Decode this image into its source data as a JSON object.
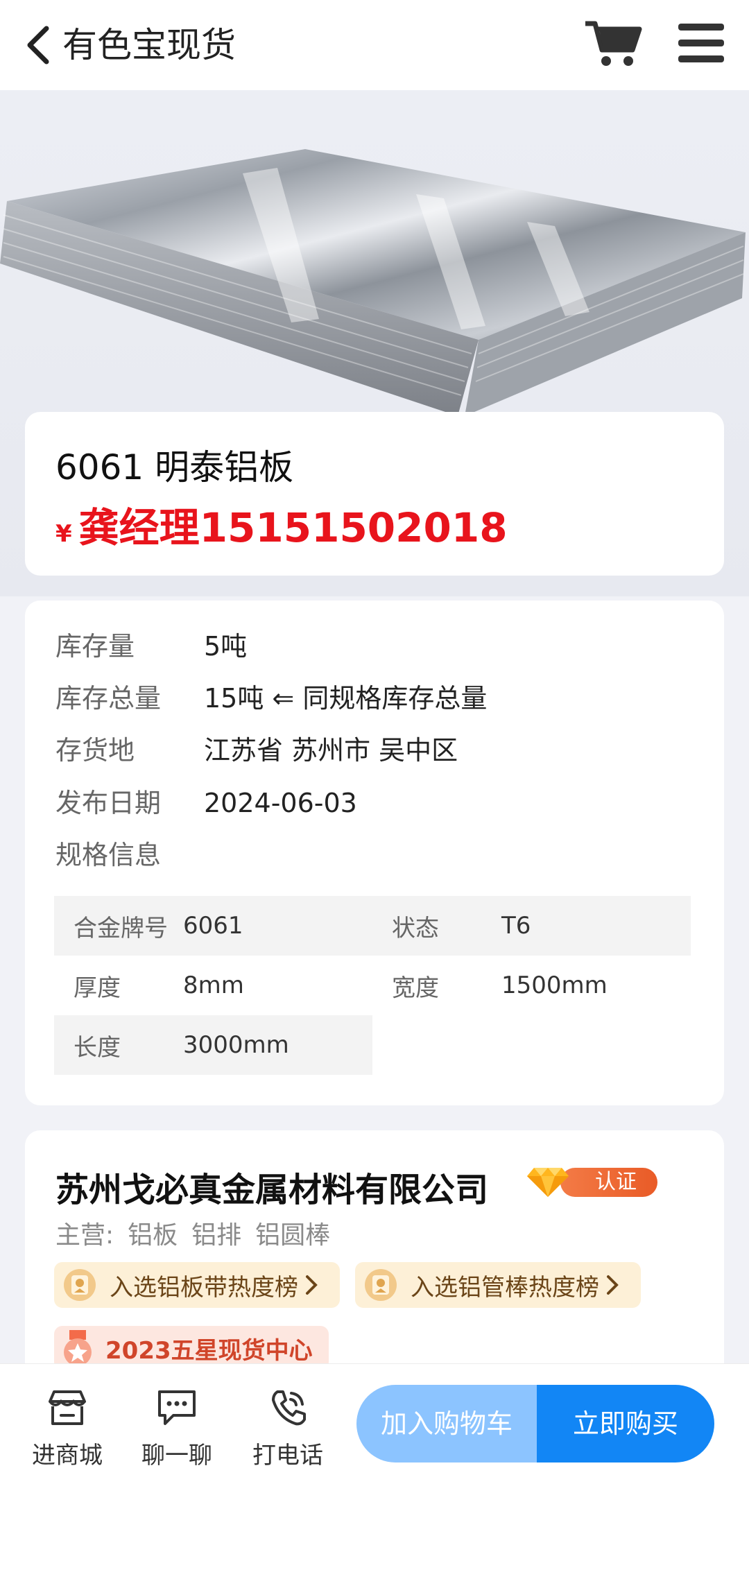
{
  "header": {
    "title": "有色宝现货"
  },
  "product": {
    "name": "6061 明泰铝板",
    "price_symbol": "¥",
    "price_text": "龚经理15151502018"
  },
  "info": {
    "stock_label": "库存量",
    "stock_value": "5吨",
    "total_label": "库存总量",
    "total_value": "15吨 ⇐ 同规格库存总量",
    "location_label": "存货地",
    "location_value": "江苏省 苏州市 吴中区",
    "date_label": "发布日期",
    "date_value": "2024-06-03",
    "spec_label": "规格信息"
  },
  "specs": {
    "alloy_label": "合金牌号",
    "alloy_value": "6061",
    "state_label": "状态",
    "state_value": "T6",
    "thickness_label": "厚度",
    "thickness_value": "8mm",
    "width_label": "宽度",
    "width_value": "1500mm",
    "length_label": "长度",
    "length_value": "3000mm"
  },
  "company": {
    "name": "苏州戈必真金属材料有限公司",
    "cert_label": "认证",
    "main_label": "主营:",
    "main_items": [
      "铝板",
      "铝排",
      "铝圆棒"
    ],
    "tag1": "入选铝板带热度榜",
    "tag2": "入选铝管棒热度榜",
    "tag3": "2023五星现货中心"
  },
  "bottom": {
    "shop_label": "进商城",
    "chat_label": "聊一聊",
    "call_label": "打电话",
    "add_cart_label": "加入购物车",
    "buy_now_label": "立即购买"
  },
  "colors": {
    "price_red": "#e8141c",
    "buy_blue": "#1286f5",
    "cart_light_blue": "#8cc4ff"
  }
}
